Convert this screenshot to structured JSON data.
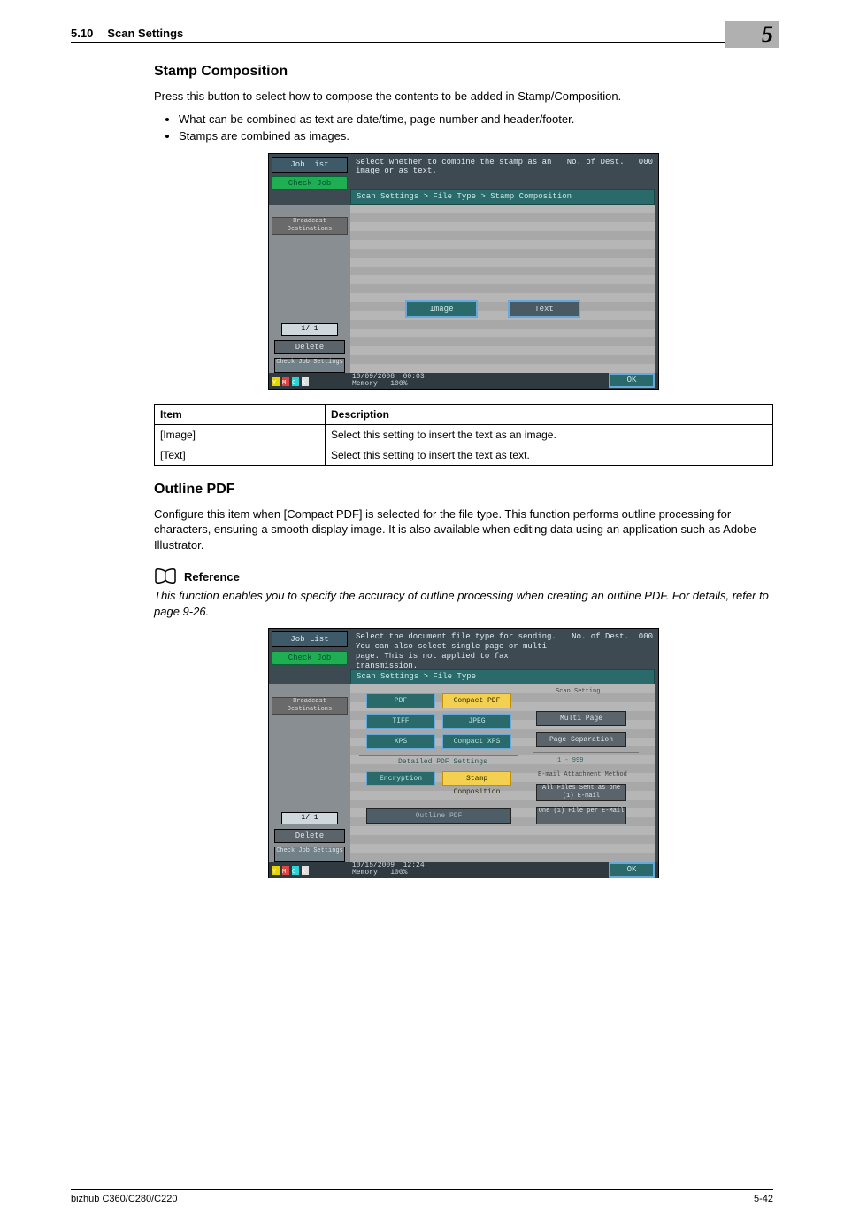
{
  "header": {
    "sec_num": "5.10",
    "sec_title": "Scan Settings",
    "chapter": "5"
  },
  "stamp": {
    "heading": "Stamp Composition",
    "intro": "Press this button to select how to compose the contents to be added in Stamp/Composition.",
    "bullets": [
      "What can be combined as text are date/time, page number and header/footer.",
      "Stamps are combined as images."
    ]
  },
  "ss1": {
    "job_list": "Job List",
    "check_job": "Check Job",
    "hint": "Select whether to combine the stamp as an image or as text.",
    "dest_label": "No. of Dest.",
    "dest_count": "000",
    "breadcrumb": "Scan Settings > File Type > Stamp Composition",
    "broadcast": "Broadcast Destinations",
    "counter": "1/   1",
    "delete": "Delete",
    "check_settings": "Check Job Settings",
    "date": "10/09/2008",
    "time": "00:03",
    "mem_label": "Memory",
    "mem_val": "100%",
    "ok": "OK",
    "btn_image": "Image",
    "btn_text": "Text"
  },
  "table1": {
    "col_item": "Item",
    "col_desc": "Description",
    "rows": [
      {
        "item": "[Image]",
        "desc": "Select this setting to insert the text as an image."
      },
      {
        "item": "[Text]",
        "desc": "Select this setting to insert the text as text."
      }
    ]
  },
  "outline": {
    "heading": "Outline PDF",
    "para": "Configure this item when [Compact PDF] is selected for the file type. This function performs outline processing for characters, ensuring a smooth display image. It is also available when editing data using an application such as Adobe Illustrator."
  },
  "reference": {
    "label": "Reference",
    "text": "This function enables you to specify the accuracy of outline processing when creating an outline PDF. For details, refer to page 9-26."
  },
  "ss2": {
    "job_list": "Job List",
    "check_job": "Check Job",
    "hint": "Select the document file type for sending. You can also select single page or multi page. This is not applied to fax transmission.",
    "dest_label": "No. of Dest.",
    "dest_count": "000",
    "breadcrumb": "Scan Settings > File Type",
    "broadcast": "Broadcast Destinations",
    "counter": "1/   1",
    "delete": "Delete",
    "check_settings": "Check Job Settings",
    "date": "10/15/2009",
    "time": "12:24",
    "mem_label": "Memory",
    "mem_val": "100%",
    "ok": "OK",
    "ft_pdf": "PDF",
    "ft_cpdf": "Compact PDF",
    "ft_tiff": "TIFF",
    "ft_jpeg": "JPEG",
    "ft_xps": "XPS",
    "ft_cxps": "Compact XPS",
    "det_label": "Detailed PDF Settings",
    "enc": "Encryption",
    "stampcomp": "Stamp Composition",
    "outlinepdf": "Outline PDF",
    "scan_setting": "Scan Setting",
    "multi_page": "Multi Page",
    "page_sep": "Page Separation",
    "range": "1   -   999",
    "email_attach": "E-mail Attachment Method",
    "all_files": "All Files Sent as one (1) E-mail",
    "one_file": "One (1) File per E-Mail"
  },
  "footer": {
    "model": "bizhub C360/C280/C220",
    "page": "5-42"
  }
}
